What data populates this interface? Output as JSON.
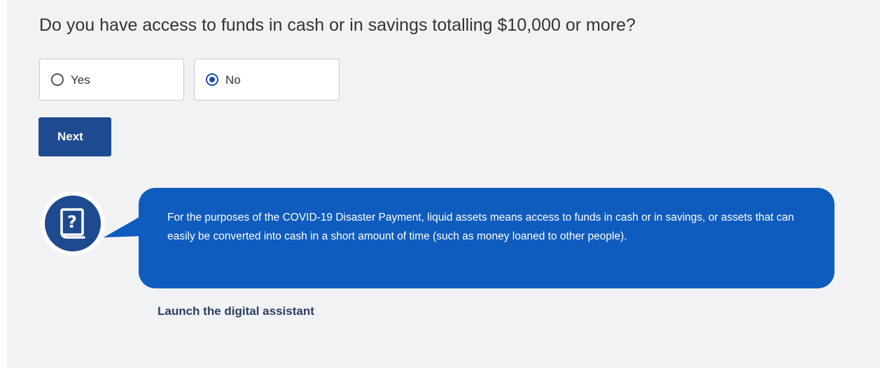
{
  "question": {
    "text": "Do you have access to funds in cash or in savings totalling $10,000 or more?"
  },
  "options": [
    {
      "label": "Yes",
      "selected": false
    },
    {
      "label": "No",
      "selected": true
    }
  ],
  "next_button": {
    "label": "Next"
  },
  "help": {
    "icon": "question-book-icon",
    "text": "For the purposes of the COVID-19 Disaster Payment, liquid assets means access to funds in cash or in savings, or assets that can easily be converted into cash in a short amount of time (such as money loaned to other people)."
  },
  "digital_assistant": {
    "link_label": "Launch the digital assistant"
  },
  "colors": {
    "panel_bg": "#f1f2f4",
    "button_bg": "#1e4a8f",
    "bubble_bg": "#0f5cbf",
    "radio_selected": "#1f4fa3",
    "link": "#2d3e63"
  }
}
